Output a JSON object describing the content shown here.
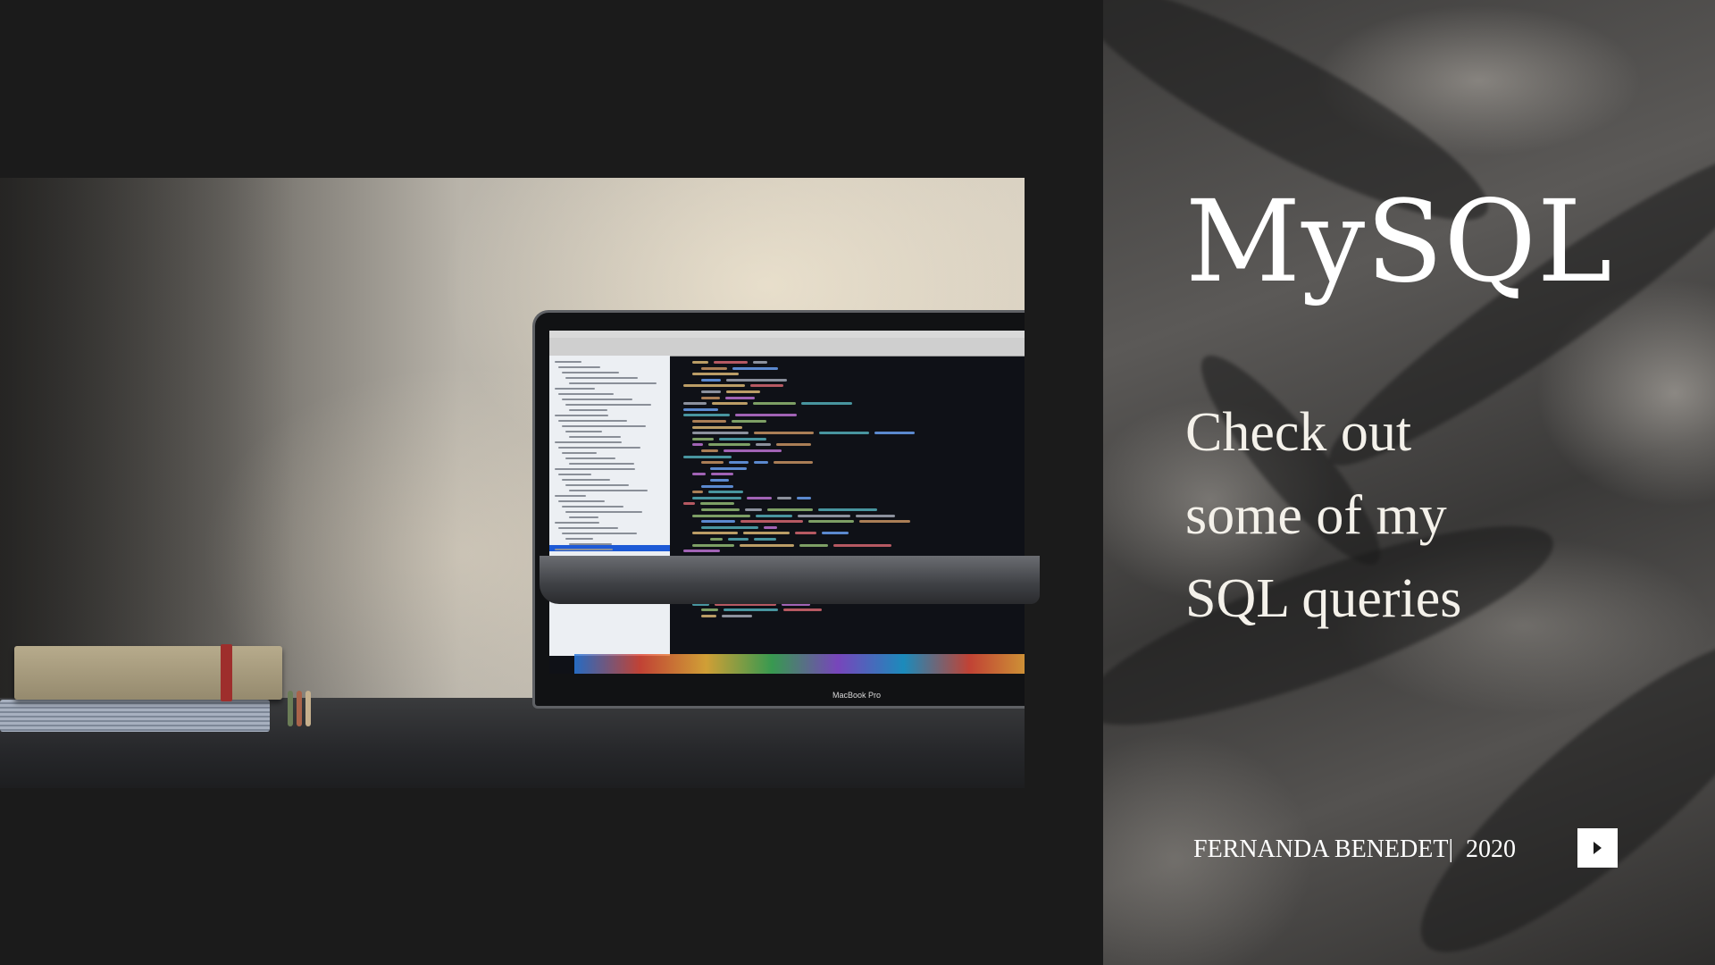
{
  "slide": {
    "title": "MySQL",
    "subtitle_lines": [
      "Check out",
      "some of my",
      "SQL queries"
    ],
    "author": "FERNANDA BENEDET|",
    "year": "2020"
  },
  "photo": {
    "laptop_label": "MacBook Pro"
  },
  "icons": {
    "next": "play-triangle-icon"
  },
  "colors": {
    "background": "#1b1b1b",
    "text": "#ffffff",
    "button": "#ffffff"
  }
}
